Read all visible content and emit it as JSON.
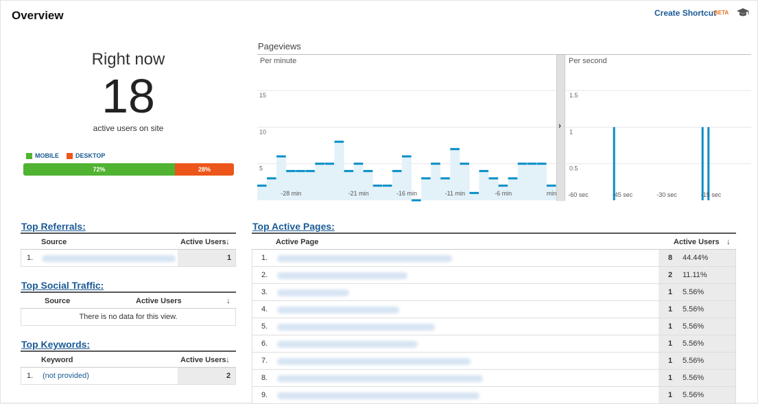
{
  "header": {
    "title": "Overview",
    "shortcut_label": "Create Shortcut",
    "beta_label": "BETA"
  },
  "realtime": {
    "heading": "Right now",
    "count": "18",
    "caption": "active users on site",
    "legend": [
      {
        "label": "MOBILE",
        "color": "#50b432"
      },
      {
        "label": "DESKTOP",
        "color": "#ed561b"
      }
    ],
    "split": [
      {
        "label": "72%",
        "value": 72,
        "color": "#50b432"
      },
      {
        "label": "28%",
        "value": 28,
        "color": "#ed561b"
      }
    ]
  },
  "pageviews": {
    "title": "Pageviews",
    "per_minute_label": "Per minute",
    "per_second_label": "Per second",
    "expand_glyph": "›"
  },
  "chart_data": [
    {
      "type": "bar",
      "title": "Per minute",
      "ylim": [
        0,
        18
      ],
      "yticks": [
        "5",
        "10",
        "15"
      ],
      "ytick_values": [
        5,
        10,
        15
      ],
      "xticks": [
        "-28 min",
        "-21 min",
        "-16 min",
        "-11 min",
        "-6 min",
        "min"
      ],
      "xtick_positions": [
        -27,
        -20,
        -15,
        -10,
        -5,
        0
      ],
      "x": [
        -30,
        -29,
        -28,
        -27,
        -26,
        -25,
        -24,
        -23,
        -22,
        -21,
        -20,
        -19,
        -18,
        -17,
        -16,
        -15,
        -14,
        -13,
        -12,
        -11,
        -10,
        -9,
        -8,
        -7,
        -6,
        -5,
        -4,
        -3,
        -2,
        -1,
        0
      ],
      "values": [
        2,
        3,
        6,
        4,
        4,
        4,
        5,
        5,
        8,
        4,
        5,
        4,
        2,
        2,
        4,
        6,
        0,
        3,
        5,
        3,
        7,
        5,
        1,
        4,
        3,
        2,
        3,
        5,
        5,
        5,
        2
      ],
      "color": "#058dc7",
      "grid": true
    },
    {
      "type": "bar",
      "title": "Per second",
      "ylim": [
        0,
        1.8
      ],
      "yticks": [
        "0.5",
        "1",
        "1.5"
      ],
      "ytick_values": [
        0.5,
        1,
        1.5
      ],
      "xticks": [
        "-60 sec",
        "-45 sec",
        "-30 sec",
        "-15 sec"
      ],
      "xtick_positions": [
        -60,
        -45,
        -30,
        -15
      ],
      "x": [
        -60,
        0
      ],
      "spikes": [
        {
          "x": -46,
          "value": 1
        },
        {
          "x": -16,
          "value": 1
        },
        {
          "x": -14,
          "value": 1
        }
      ],
      "color": "#058dc7",
      "grid": true
    }
  ],
  "referrals": {
    "title": "Top Referrals:",
    "col_source": "Source",
    "col_users": "Active Users",
    "rows": [
      {
        "index": "1.",
        "value": "1"
      }
    ]
  },
  "social": {
    "title": "Top Social Traffic:",
    "col_source": "Source",
    "col_users": "Active Users",
    "empty_text": "There is no data for this view."
  },
  "keywords": {
    "title": "Top Keywords:",
    "col_keyword": "Keyword",
    "col_users": "Active Users",
    "rows": [
      {
        "index": "1.",
        "keyword": "(not provided)",
        "value": "2"
      }
    ]
  },
  "pages": {
    "title": "Top Active Pages:",
    "col_page": "Active Page",
    "col_users": "Active Users",
    "rows": [
      {
        "index": "1.",
        "value": "8",
        "pct": "44.44%"
      },
      {
        "index": "2.",
        "value": "2",
        "pct": "11.11%"
      },
      {
        "index": "3.",
        "value": "1",
        "pct": "5.56%"
      },
      {
        "index": "4.",
        "value": "1",
        "pct": "5.56%"
      },
      {
        "index": "5.",
        "value": "1",
        "pct": "5.56%"
      },
      {
        "index": "6.",
        "value": "1",
        "pct": "5.56%"
      },
      {
        "index": "7.",
        "value": "1",
        "pct": "5.56%"
      },
      {
        "index": "8.",
        "value": "1",
        "pct": "5.56%"
      },
      {
        "index": "9.",
        "value": "1",
        "pct": "5.56%"
      }
    ]
  }
}
